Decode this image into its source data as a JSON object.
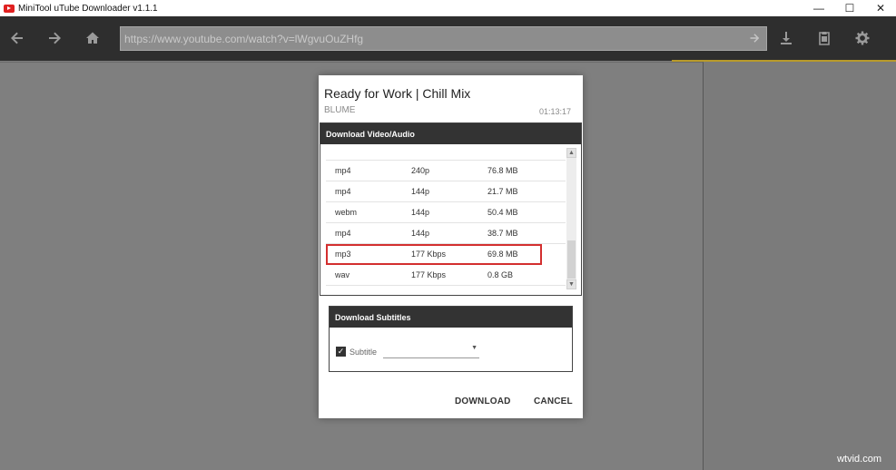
{
  "window": {
    "title": "MiniTool uTube Downloader v1.1.1",
    "controls": {
      "minimize": "—",
      "maximize": "☐",
      "close": "✕"
    }
  },
  "toolbar": {
    "icons": [
      "back-icon",
      "forward-icon",
      "home-icon",
      "go-icon",
      "download-icon",
      "clipboard-icon",
      "gear-icon"
    ],
    "url_value": "https://www.youtube.com/watch?v=lWgvuOuZHfg",
    "accent_color": "#b89a2a"
  },
  "dialog": {
    "title": "Ready for Work | Chill Mix",
    "channel": "BLUME",
    "duration": "01:13:17",
    "video_section": {
      "header": "Download Video/Audio",
      "rows": [
        {
          "format": "mp4",
          "quality": "240p",
          "size": "76.8 MB"
        },
        {
          "format": "mp4",
          "quality": "144p",
          "size": "21.7 MB"
        },
        {
          "format": "webm",
          "quality": "144p",
          "size": "50.4 MB"
        },
        {
          "format": "mp4",
          "quality": "144p",
          "size": "38.7 MB"
        },
        {
          "format": "mp3",
          "quality": "177 Kbps",
          "size": "69.8 MB"
        },
        {
          "format": "wav",
          "quality": "177 Kbps",
          "size": "0.8 GB"
        }
      ],
      "selected_index": 4,
      "highlight_color": "#d32f2f"
    },
    "subtitle_section": {
      "header": "Download Subtitles",
      "checkbox_label": "Subtitle",
      "checked": true,
      "selected_value": ""
    },
    "buttons": {
      "download": "DOWNLOAD",
      "cancel": "CANCEL"
    }
  },
  "watermark": "wtvid.com"
}
